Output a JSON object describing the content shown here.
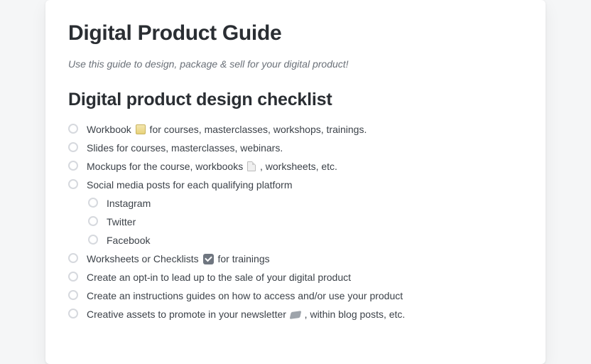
{
  "title": "Digital Product Guide",
  "subtitle": "Use this guide to design, package & sell for your digital product!",
  "section_heading": "Digital product design checklist",
  "checklist": [
    {
      "pre": "Workbook ",
      "icon": "clipboard",
      "post": " for courses, masterclasses, workshops, trainings."
    },
    {
      "pre": "Slides for courses, masterclasses, webinars."
    },
    {
      "pre": "Mockups for the course, workbooks ",
      "icon": "doc",
      "post": " , worksheets, etc."
    },
    {
      "pre": "Social media posts for each qualifying platform",
      "children": [
        {
          "pre": "Instagram"
        },
        {
          "pre": "Twitter"
        },
        {
          "pre": "Facebook"
        }
      ]
    },
    {
      "pre": "Worksheets or Checklists ",
      "icon": "check",
      "post": " for trainings"
    },
    {
      "pre": "Create an opt-in to lead up to the sale of your digital product"
    },
    {
      "pre": "Create an instructions guides on how to access and/or use your product"
    },
    {
      "pre": "Creative assets to promote in your newsletter ",
      "icon": "tag",
      "post": " , within blog posts, etc."
    }
  ]
}
